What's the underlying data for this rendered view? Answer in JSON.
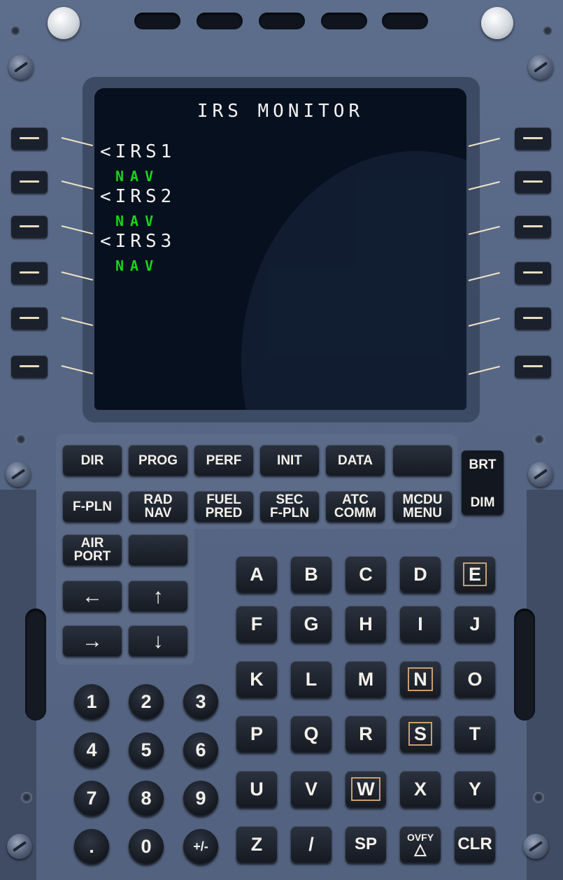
{
  "screen": {
    "title": "IRS MONITOR",
    "lines": [
      {
        "label": "<IRS1",
        "status": "NAV"
      },
      {
        "label": "<IRS2",
        "status": "NAV"
      },
      {
        "label": "<IRS3",
        "status": "NAV"
      }
    ]
  },
  "function_keys": {
    "row1": [
      "DIR",
      "PROG",
      "PERF",
      "INIT",
      "DATA",
      ""
    ],
    "row2": [
      "F-PLN",
      "RAD\nNAV",
      "FUEL\nPRED",
      "SEC\nF-PLN",
      "ATC\nCOMM",
      "MCDU\nMENU"
    ],
    "airport": "AIR\nPORT",
    "blank": ""
  },
  "brightness": {
    "brt": "BRT",
    "dim": "DIM"
  },
  "alpha_keys": [
    "A",
    "B",
    "C",
    "D",
    "E",
    "F",
    "G",
    "H",
    "I",
    "J",
    "K",
    "L",
    "M",
    "N",
    "O",
    "P",
    "Q",
    "R",
    "S",
    "T",
    "U",
    "V",
    "W",
    "X",
    "Y",
    "Z",
    "/",
    "SP",
    "OVFY",
    "CLR"
  ],
  "numeric_keys": [
    "1",
    "2",
    "3",
    "4",
    "5",
    "6",
    "7",
    "8",
    "9",
    ".",
    "0",
    "+/-"
  ],
  "arrows": {
    "left": "←",
    "up": "↑",
    "right": "→",
    "down": "↓"
  },
  "colors": {
    "screen_white": "#f2f2f2",
    "screen_green": "#19d419",
    "panel": "#566685"
  }
}
